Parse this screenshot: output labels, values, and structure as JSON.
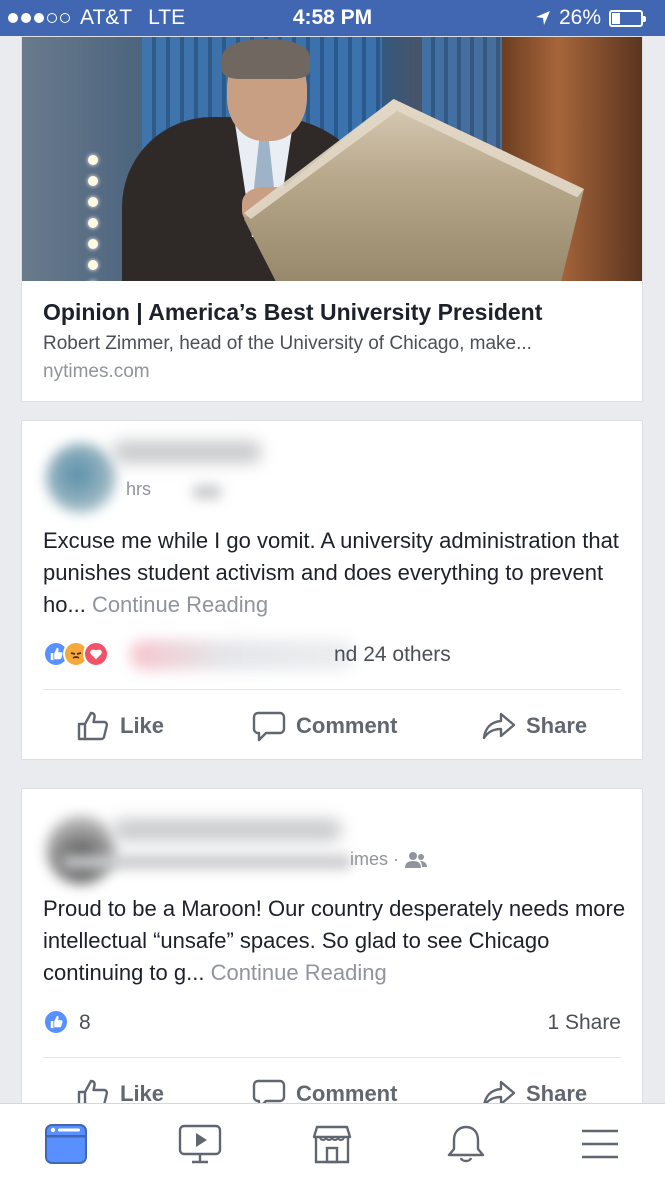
{
  "status_bar": {
    "carrier": "AT&T",
    "network": "LTE",
    "time": "4:58 PM",
    "battery": "26%",
    "battery_level": 0.26,
    "signal_bars": 3,
    "signal_total": 5
  },
  "link_card": {
    "image_icon": "speaker-at-podium-photo",
    "title": "Opinion | America’s Best University President",
    "description": "Robert Zimmer, head of the University of Chicago, make...",
    "domain": "nytimes.com"
  },
  "posts": [
    {
      "meta": "hrs",
      "text": "Excuse me while I go vomit. A university administration that punishes student activism and does everything to prevent ho...",
      "continue_label": "Continue Reading",
      "reaction_icons": [
        "like-reaction-icon",
        "angry-reaction-icon",
        "love-reaction-icon"
      ],
      "reaction_summary": "nd 24 others",
      "share_count": ""
    },
    {
      "meta": "imes ·",
      "meta_icon": "friends-audience-icon",
      "text": "Proud to be a Maroon! Our country desperately needs more intellectual “unsafe” spaces. So glad to see Chicago continuing to g...",
      "continue_label": "Continue Reading",
      "reaction_icons": [
        "like-reaction-icon"
      ],
      "reaction_summary": "8",
      "share_count": "1 Share"
    }
  ],
  "actions": {
    "like": "Like",
    "comment": "Comment",
    "share": "Share"
  },
  "tab_bar": [
    "news-feed-icon",
    "video-icon",
    "marketplace-icon",
    "notifications-icon",
    "menu-icon"
  ],
  "colors": {
    "brand": "#4267b2",
    "like_blue": "#5890ff",
    "muted_text": "#90949c",
    "action_gray": "#606770",
    "background": "#e9ebee"
  }
}
